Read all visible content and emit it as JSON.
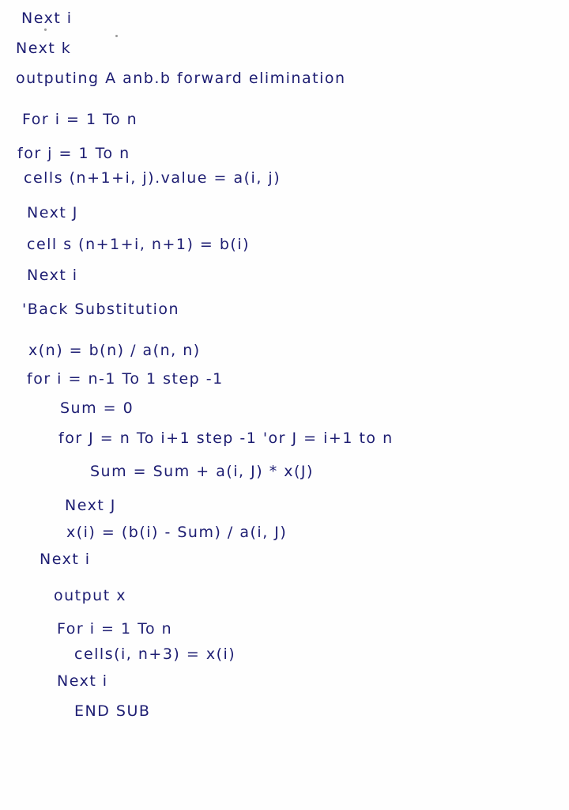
{
  "document": {
    "type": "handwritten-pseudocode",
    "ink_color": "#1d1d72",
    "lines": [
      "Next i",
      "Next k",
      "outputing A anb.b forward elimination",
      "For i = 1 To n",
      "for j = 1 To n",
      "cells (n+1+i, j).value = a(i, j)",
      "Next J",
      "cell s (n+1+i, n+1) = b(i)",
      "Next i",
      "'Back Substitution",
      "x(n) = b(n) / a(n, n)",
      "for i = n-1 To 1 step -1",
      "Sum = 0",
      "for J = n To i+1 step -1 'or J = i+1 to n",
      "Sum = Sum + a(i, J) * x(J)",
      "Next J",
      "x(i) = (b(i) - Sum) / a(i, J)",
      "Next i",
      "output x",
      "For i = 1 To n",
      "cells(i, n+3) = x(i)",
      "Next i",
      "END SUB"
    ]
  }
}
